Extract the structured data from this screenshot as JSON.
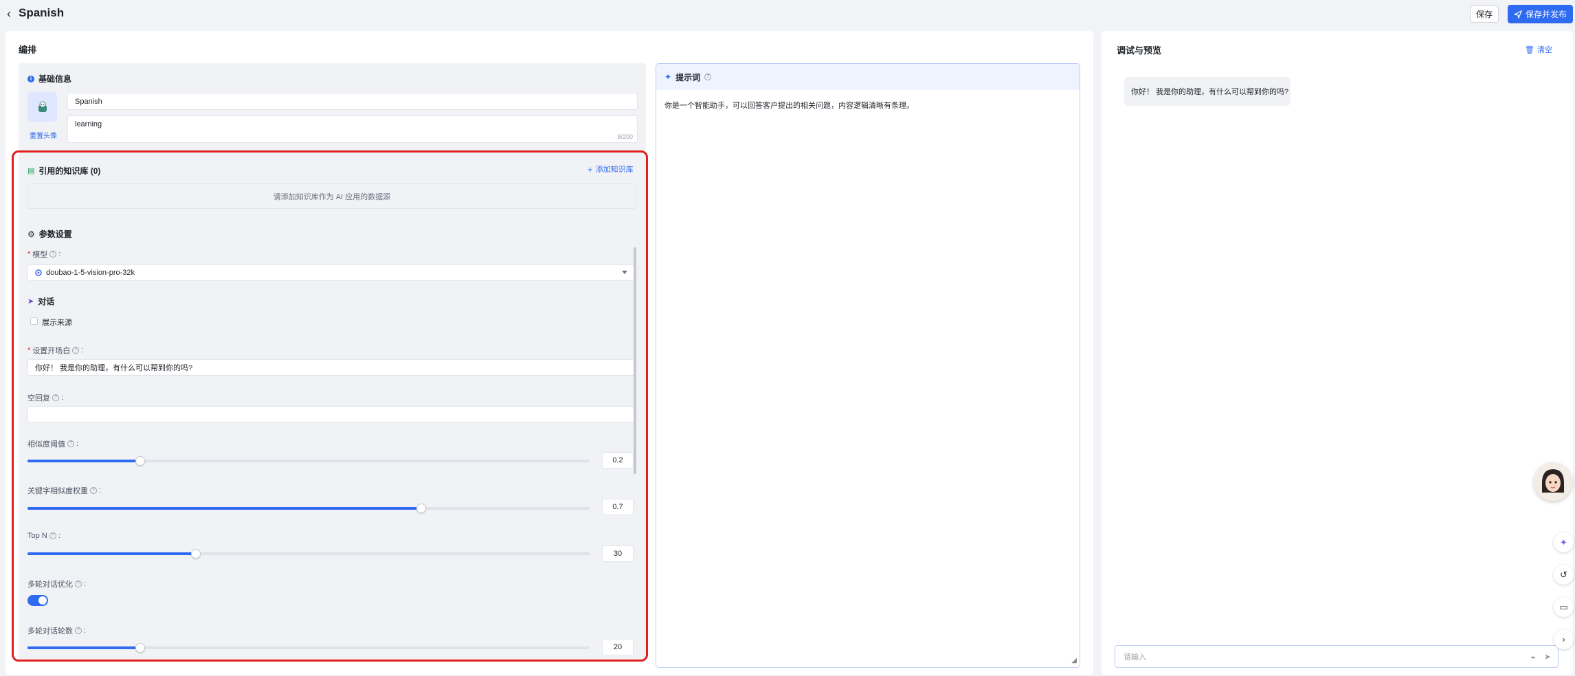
{
  "header": {
    "title": "Spanish",
    "save_label": "保存",
    "publish_label": "保存并发布"
  },
  "left": {
    "title": "编排",
    "basic_info": {
      "title": "基础信息",
      "name_value": "Spanish",
      "desc_value": "learning",
      "counter": "8/200",
      "reset_avatar": "重置头像"
    },
    "knowledge": {
      "title": "引用的知识库 (0)",
      "add_label": "添加知识库",
      "empty_text": "请添加知识库作为 AI 应用的数据源"
    },
    "params": {
      "title": "参数设置",
      "model_label": "模型",
      "model_value": "doubao-1-5-vision-pro-32k",
      "dialog_title": "对话",
      "show_source": "展示来源",
      "opening_label": "设置开场白",
      "opening_value": "你好！ 我是你的助理，有什么可以帮到你的吗?",
      "empty_reply_label": "空回复",
      "empty_reply_value": "",
      "similarity_label": "相似度阈值",
      "similarity_value": "0.2",
      "similarity_fraction": 0.2,
      "keyword_weight_label": "关键字相似度权重",
      "keyword_weight_value": "0.7",
      "keyword_weight_fraction": 0.7,
      "topn_label": "Top N",
      "topn_value": "30",
      "topn_fraction": 0.3,
      "multi_opt_label": "多轮对话优化",
      "multi_opt_on": true,
      "multi_rounds_label": "多轮对话轮数",
      "multi_rounds_value": "20",
      "multi_rounds_fraction": 0.2
    }
  },
  "prompt": {
    "title": "提示词",
    "text": "你是一个智能助手，可以回答客户提出的相关问题，内容逻辑清晰有条理。"
  },
  "preview": {
    "title": "调试与预览",
    "clear_label": "清空",
    "greeting": "你好！ 我是你的助理，有什么可以帮到你的吗?",
    "input_placeholder": "请输入"
  },
  "colors": {
    "accent": "#2f6bf0",
    "highlight": "#e0201c"
  }
}
